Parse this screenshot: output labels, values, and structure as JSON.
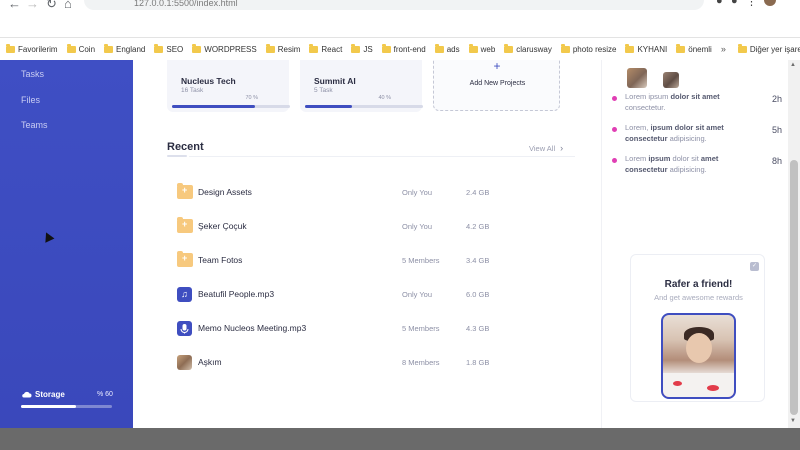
{
  "browser": {
    "url": "127.0.0.1:5500/index.html",
    "bookmarks": [
      "Favorilerim",
      "Coin",
      "England",
      "SEO",
      "WORDPRESS",
      "Resim",
      "React",
      "JS",
      "front-end",
      "ads",
      "web",
      "clarusway",
      "photo resize",
      "KYHANI",
      "önemli"
    ],
    "more_bookmarks_icon": "double-chevron-icon",
    "other_bookmarks": "Diğer yer işaretleri"
  },
  "sidebar": {
    "items": [
      {
        "label": "Tasks"
      },
      {
        "label": "Files"
      },
      {
        "label": "Teams"
      }
    ],
    "storage": {
      "label": "Storage",
      "percent_text": "% 60",
      "percent": 60,
      "icon": "cloud-icon"
    }
  },
  "projects": [
    {
      "name": "Nucleus Tech",
      "tasks": "16 Task",
      "percent_text": "70 %",
      "progress": 70
    },
    {
      "name": "Summit AI",
      "tasks": "5 Task",
      "percent_text": "40 %",
      "progress": 40
    }
  ],
  "add_project": {
    "label": "Add New Projects",
    "icon": "plus-icon"
  },
  "recent": {
    "title": "Recent",
    "view_all": "View All",
    "files": [
      {
        "name": "Design Assets",
        "owner": "Only You",
        "size": "2.4 GB",
        "icon": "folder-icon"
      },
      {
        "name": "Şeker Çoçuk",
        "owner": "Only You",
        "size": "4.2 GB",
        "icon": "folder-icon"
      },
      {
        "name": "Team Fotos",
        "owner": "5 Members",
        "size": "3.4 GB",
        "icon": "folder-icon"
      },
      {
        "name": "Beatufil People.mp3",
        "owner": "Only You",
        "size": "6.0 GB",
        "icon": "music-icon"
      },
      {
        "name": "Memo Nucleos Meeting.mp3",
        "owner": "5 Members",
        "size": "4.3 GB",
        "icon": "microphone-icon"
      },
      {
        "name": "Aşkım",
        "owner": "8 Members",
        "size": "1.8 GB",
        "icon": "photo-thumbnail"
      }
    ]
  },
  "activity": [
    {
      "pre": "Lorem ipsum ",
      "bold": "dolor sit amet",
      "post": " consectetur.",
      "time": "2h"
    },
    {
      "pre": "Lorem, ",
      "bold": "ipsum dolor sit amet consectetur",
      "post": " adipisicing.",
      "time": "5h"
    },
    {
      "pre": "Lorem ",
      "bold": "ipsum",
      "mid": " dolor sit ",
      "bold2": "amet consectetur",
      "post": " adipisicing.",
      "time": "8h"
    }
  ],
  "refer": {
    "title": "Rafer a friend!",
    "subtitle": "And get awesome rewards",
    "check_icon": "check-icon"
  },
  "colors": {
    "sidebar": "#3f4ec0",
    "accent": "#3f4ec0",
    "activity_dot": "#e03fb4",
    "folder": "#f7c97e"
  }
}
